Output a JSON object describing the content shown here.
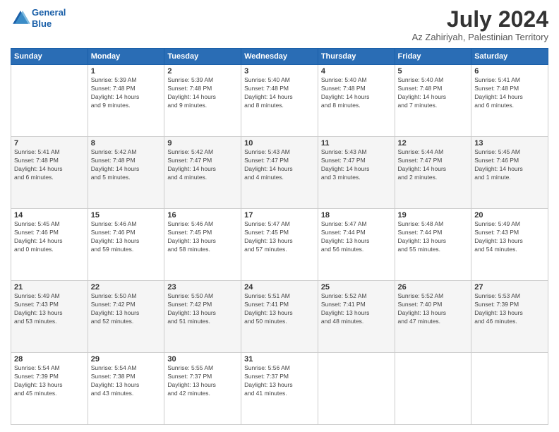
{
  "header": {
    "logo_line1": "General",
    "logo_line2": "Blue",
    "title": "July 2024",
    "subtitle": "Az Zahiriyah, Palestinian Territory"
  },
  "calendar": {
    "days_of_week": [
      "Sunday",
      "Monday",
      "Tuesday",
      "Wednesday",
      "Thursday",
      "Friday",
      "Saturday"
    ],
    "weeks": [
      [
        {
          "day": "",
          "info": ""
        },
        {
          "day": "1",
          "info": "Sunrise: 5:39 AM\nSunset: 7:48 PM\nDaylight: 14 hours\nand 9 minutes."
        },
        {
          "day": "2",
          "info": "Sunrise: 5:39 AM\nSunset: 7:48 PM\nDaylight: 14 hours\nand 9 minutes."
        },
        {
          "day": "3",
          "info": "Sunrise: 5:40 AM\nSunset: 7:48 PM\nDaylight: 14 hours\nand 8 minutes."
        },
        {
          "day": "4",
          "info": "Sunrise: 5:40 AM\nSunset: 7:48 PM\nDaylight: 14 hours\nand 8 minutes."
        },
        {
          "day": "5",
          "info": "Sunrise: 5:40 AM\nSunset: 7:48 PM\nDaylight: 14 hours\nand 7 minutes."
        },
        {
          "day": "6",
          "info": "Sunrise: 5:41 AM\nSunset: 7:48 PM\nDaylight: 14 hours\nand 6 minutes."
        }
      ],
      [
        {
          "day": "7",
          "info": "Sunrise: 5:41 AM\nSunset: 7:48 PM\nDaylight: 14 hours\nand 6 minutes."
        },
        {
          "day": "8",
          "info": "Sunrise: 5:42 AM\nSunset: 7:48 PM\nDaylight: 14 hours\nand 5 minutes."
        },
        {
          "day": "9",
          "info": "Sunrise: 5:42 AM\nSunset: 7:47 PM\nDaylight: 14 hours\nand 4 minutes."
        },
        {
          "day": "10",
          "info": "Sunrise: 5:43 AM\nSunset: 7:47 PM\nDaylight: 14 hours\nand 4 minutes."
        },
        {
          "day": "11",
          "info": "Sunrise: 5:43 AM\nSunset: 7:47 PM\nDaylight: 14 hours\nand 3 minutes."
        },
        {
          "day": "12",
          "info": "Sunrise: 5:44 AM\nSunset: 7:47 PM\nDaylight: 14 hours\nand 2 minutes."
        },
        {
          "day": "13",
          "info": "Sunrise: 5:45 AM\nSunset: 7:46 PM\nDaylight: 14 hours\nand 1 minute."
        }
      ],
      [
        {
          "day": "14",
          "info": "Sunrise: 5:45 AM\nSunset: 7:46 PM\nDaylight: 14 hours\nand 0 minutes."
        },
        {
          "day": "15",
          "info": "Sunrise: 5:46 AM\nSunset: 7:46 PM\nDaylight: 13 hours\nand 59 minutes."
        },
        {
          "day": "16",
          "info": "Sunrise: 5:46 AM\nSunset: 7:45 PM\nDaylight: 13 hours\nand 58 minutes."
        },
        {
          "day": "17",
          "info": "Sunrise: 5:47 AM\nSunset: 7:45 PM\nDaylight: 13 hours\nand 57 minutes."
        },
        {
          "day": "18",
          "info": "Sunrise: 5:47 AM\nSunset: 7:44 PM\nDaylight: 13 hours\nand 56 minutes."
        },
        {
          "day": "19",
          "info": "Sunrise: 5:48 AM\nSunset: 7:44 PM\nDaylight: 13 hours\nand 55 minutes."
        },
        {
          "day": "20",
          "info": "Sunrise: 5:49 AM\nSunset: 7:43 PM\nDaylight: 13 hours\nand 54 minutes."
        }
      ],
      [
        {
          "day": "21",
          "info": "Sunrise: 5:49 AM\nSunset: 7:43 PM\nDaylight: 13 hours\nand 53 minutes."
        },
        {
          "day": "22",
          "info": "Sunrise: 5:50 AM\nSunset: 7:42 PM\nDaylight: 13 hours\nand 52 minutes."
        },
        {
          "day": "23",
          "info": "Sunrise: 5:50 AM\nSunset: 7:42 PM\nDaylight: 13 hours\nand 51 minutes."
        },
        {
          "day": "24",
          "info": "Sunrise: 5:51 AM\nSunset: 7:41 PM\nDaylight: 13 hours\nand 50 minutes."
        },
        {
          "day": "25",
          "info": "Sunrise: 5:52 AM\nSunset: 7:41 PM\nDaylight: 13 hours\nand 48 minutes."
        },
        {
          "day": "26",
          "info": "Sunrise: 5:52 AM\nSunset: 7:40 PM\nDaylight: 13 hours\nand 47 minutes."
        },
        {
          "day": "27",
          "info": "Sunrise: 5:53 AM\nSunset: 7:39 PM\nDaylight: 13 hours\nand 46 minutes."
        }
      ],
      [
        {
          "day": "28",
          "info": "Sunrise: 5:54 AM\nSunset: 7:39 PM\nDaylight: 13 hours\nand 45 minutes."
        },
        {
          "day": "29",
          "info": "Sunrise: 5:54 AM\nSunset: 7:38 PM\nDaylight: 13 hours\nand 43 minutes."
        },
        {
          "day": "30",
          "info": "Sunrise: 5:55 AM\nSunset: 7:37 PM\nDaylight: 13 hours\nand 42 minutes."
        },
        {
          "day": "31",
          "info": "Sunrise: 5:56 AM\nSunset: 7:37 PM\nDaylight: 13 hours\nand 41 minutes."
        },
        {
          "day": "",
          "info": ""
        },
        {
          "day": "",
          "info": ""
        },
        {
          "day": "",
          "info": ""
        }
      ]
    ]
  }
}
